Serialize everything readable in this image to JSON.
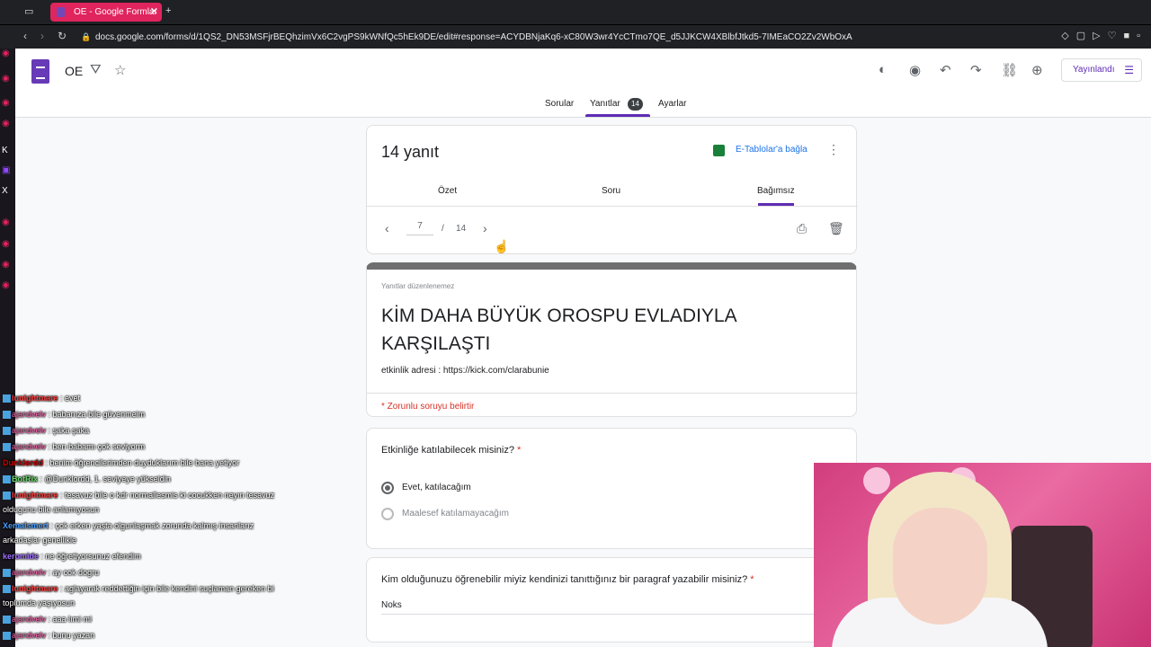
{
  "browser": {
    "tab_title": "OE - Google Formlar",
    "url": "docs.google.com/forms/d/1QS2_DN53MSFjrBEQhzimVx6C2vgPS9kWNfQc5hEk9DE/edit#response=ACYDBNjaKq6-xC80W3wr4YcCTmo7QE_d5JJKCW4XBlbfJtkd5-7IMEaCO2Zv2WbOxA"
  },
  "header": {
    "form_name": "OE",
    "publish_label": "Yayınlandı"
  },
  "nav": {
    "questions": "Sorular",
    "responses": "Yanıtlar",
    "responses_count": "14",
    "settings": "Ayarlar"
  },
  "summary": {
    "count_label": "14 yanıt",
    "link_sheets": "E-Tablolar'a bağla",
    "tabs": [
      "Özet",
      "Soru",
      "Bağımsız"
    ],
    "current_page": "7",
    "separator": "/",
    "total_pages": "14"
  },
  "response": {
    "readonly_note": "Yanıtlar düzenlenemez",
    "title": "KİM DAHA BÜYÜK OROSPU EVLADIYLA KARŞILAŞTI",
    "description": "etkinlik adresi : https://kick.com/clarabunie",
    "required_note": "* Zorunlu soruyu belirtir"
  },
  "question1": {
    "text": "Etkinliğe katılabilecek misiniz?",
    "required_mark": "*",
    "options": [
      "Evet, katılacağım",
      "Maalesef katılamayacağım"
    ],
    "selected_index": 0
  },
  "question2": {
    "text": "Kim olduğunuzu öğrenebilir miyiz kendinizi tanıttığınız bir paragraf yazabilir misiniz?",
    "required_mark": "*",
    "answer": "Noks"
  },
  "chat": [
    {
      "user": "lunightmare",
      "text": ": evet"
    },
    {
      "user": "ajandvelv",
      "text": ": babanıza bile güvenmeim"
    },
    {
      "user": "ajandvelv",
      "text": ": şaka şaka"
    },
    {
      "user": "ajandvelv",
      "text": ": ben babamı çok seviyorm"
    },
    {
      "user": "Dunklordd",
      "text": ": benim öğrencilerimden duyduklarım bile bana yetiyor"
    },
    {
      "user": "BotRix",
      "text": ": @Dunklordd, 1. seviyeye yükseldin"
    },
    {
      "user": "lunightmare",
      "text": ": tesavuz bile o kdr normallesmis ki cocukken neyın tesavuz"
    },
    {
      "user": "",
      "text": "oldugunu bile anlamıyosun"
    },
    {
      "user": "Xemalsmert",
      "text": ": çok erken yaşta olgunlaşmak zorunda kalmış insanlarız"
    },
    {
      "user": "",
      "text": "arkadaşlar genellikle"
    },
    {
      "user": "keromide",
      "text": ": ne öğretiyorsunuz efendim"
    },
    {
      "user": "ajandvelv",
      "text": ": ay cok dogru"
    },
    {
      "user": "lunightmare",
      "text": ": aglayarak reddettiğin için bile kendini suçlaman gereken bi"
    },
    {
      "user": "",
      "text": "toplumda yaşıyosun"
    },
    {
      "user": "ajandvelv",
      "text": ": aaa lımi mi"
    },
    {
      "user": "ajandvelv",
      "text": ": bunu yazan"
    }
  ]
}
